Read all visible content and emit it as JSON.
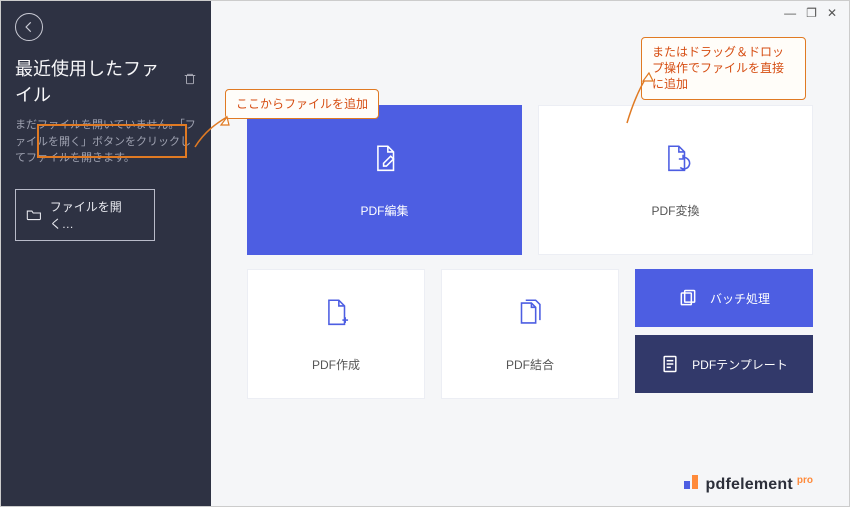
{
  "window": {
    "minimize": "—",
    "maximize": "❐",
    "close": "✕"
  },
  "sidebar": {
    "title": "最近使用したファイル",
    "help": "まだファイルを開いていません。「ファイルを開く」ボタンをクリックしてファイルを開きます。",
    "open_button": "ファイルを開く…"
  },
  "tiles": {
    "edit": "PDF編集",
    "convert": "PDF変換",
    "create": "PDF作成",
    "combine": "PDF結合",
    "batch": "バッチ処理",
    "template": "PDFテンプレート"
  },
  "brand": {
    "prefix": "pdf",
    "suffix": "element",
    "pro": "pro"
  },
  "annotation": {
    "left": "ここからファイルを追加",
    "right": "またはドラッグ＆ドロップ操作でファイルを直接に追加"
  }
}
